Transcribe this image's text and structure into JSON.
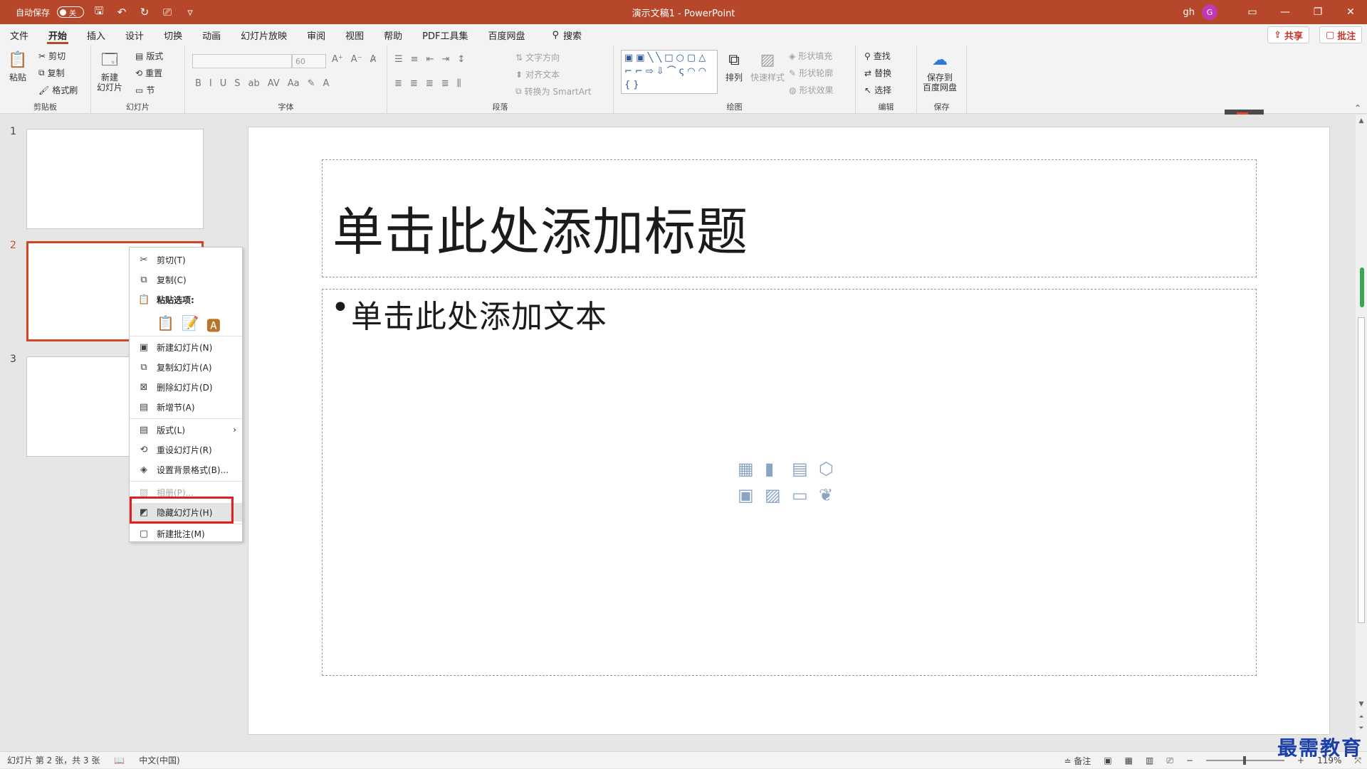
{
  "titlebar": {
    "autosave_label": "自动保存",
    "autosave_state": "关",
    "doc_title": "演示文稿1 - PowerPoint",
    "user_name": "gh",
    "avatar_initial": "G"
  },
  "menu": {
    "tabs": [
      "文件",
      "开始",
      "插入",
      "设计",
      "切换",
      "动画",
      "幻灯片放映",
      "审阅",
      "视图",
      "帮助",
      "PDF工具集",
      "百度网盘"
    ],
    "active_tab": "开始",
    "search_label": "搜索",
    "share_label": "共享",
    "comment_label": "批注"
  },
  "ribbon": {
    "clipboard": {
      "paste": "粘贴",
      "cut": "剪切",
      "copy": "复制",
      "format_painter": "格式刷",
      "label": "剪贴板"
    },
    "slides": {
      "new_slide": "新建\n幻灯片",
      "layout": "版式",
      "reset": "重置",
      "section": "节",
      "label": "幻灯片"
    },
    "font": {
      "font_size": "60",
      "label": "字体"
    },
    "paragraph": {
      "text_direction": "文字方向",
      "align_text": "对齐文本",
      "convert_smartart": "转换为 SmartArt",
      "label": "段落"
    },
    "drawing": {
      "arrange": "排列",
      "quick_styles": "快速样式",
      "shape_fill": "形状填充",
      "shape_outline": "形状轮廓",
      "shape_effects": "形状效果",
      "label": "绘图"
    },
    "editing": {
      "find": "查找",
      "replace": "替换",
      "select": "选择",
      "label": "编辑"
    },
    "save": {
      "save_baidu": "保存到\n百度网盘",
      "label": "保存"
    }
  },
  "thumbnails": {
    "numbers": [
      "1",
      "2",
      "3"
    ]
  },
  "slide": {
    "title_placeholder": "单击此处添加标题",
    "body_placeholder": "单击此处添加文本",
    "bullet": "•"
  },
  "context_menu": {
    "cut": "剪切(T)",
    "copy": "复制(C)",
    "paste_options": "粘贴选项:",
    "new_slide": "新建幻灯片(N)",
    "duplicate_slide": "复制幻灯片(A)",
    "delete_slide": "删除幻灯片(D)",
    "new_section": "新增节(A)",
    "layout": "版式(L)",
    "reset_slide": "重设幻灯片(R)",
    "format_background": "设置背景格式(B)...",
    "photo_album": "相册(P)...",
    "hide_slide": "隐藏幻灯片(H)",
    "new_comment": "新建批注(M)"
  },
  "statusbar": {
    "slide_info": "幻灯片 第 2 张，共 3 张",
    "language": "中文(中国)",
    "notes": "备注",
    "zoom": "119%"
  },
  "watermark": "最需教育",
  "colors": {
    "accent": "#b7472a",
    "highlight": "#e02020",
    "selected_border": "#d24726"
  }
}
